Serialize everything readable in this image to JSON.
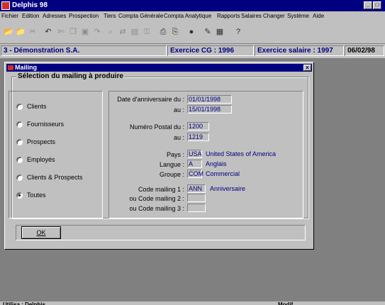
{
  "window": {
    "title": "Delphis 98"
  },
  "menu": [
    "Fichier",
    "Edition",
    "Adresses",
    "Prospection",
    "Tiers",
    "Compta Générale",
    "Compta Analytique",
    "Rapports",
    "Salaires",
    "Changer",
    "Système",
    "Aide"
  ],
  "toolbar": {
    "icons": [
      "open-folder-icon",
      "edit-folder-icon",
      "tools-icon",
      "undo-icon",
      "cut-icon",
      "copy-icon",
      "paste-icon",
      "redo-icon",
      "find-icon",
      "replace-icon",
      "calculator-icon",
      "key-icon",
      "print-preview-icon",
      "print-icon",
      "globe-icon",
      "edit-document-icon",
      "film-icon",
      "help-icon"
    ]
  },
  "status": {
    "company": "3 - Démonstration S.A.",
    "exercice_cg": "Exercice CG : 1996",
    "exercice_salaire": "Exercice salaire :  1997",
    "date": "06/02/98"
  },
  "dialog": {
    "title": "Mailing",
    "group_title": "Sélection du mailing à produire",
    "options": [
      {
        "label": "Clients",
        "selected": false
      },
      {
        "label": "Fournisseurs",
        "selected": false
      },
      {
        "label": "Prospects",
        "selected": false
      },
      {
        "label": "Employés",
        "selected": false
      },
      {
        "label": "Clients & Prospects",
        "selected": false
      },
      {
        "label": "Toutes",
        "selected": true
      }
    ],
    "fields": {
      "date_anniv_du_label": "Date d'anniversaire du :",
      "date_anniv_du": "01/01/1998",
      "date_anniv_au_label": "au :",
      "date_anniv_au": "15/01/1998",
      "npa_du_label": "Numéro Postal du :",
      "npa_du": "1200",
      "npa_au_label": "au :",
      "npa_au": "1219",
      "pays_label": "Pays :",
      "pays_code": "USA",
      "pays_name": "United States of America",
      "langue_label": "Langue :",
      "langue_code": "A",
      "langue_name": "Anglais",
      "groupe_label": "Groupe :",
      "groupe_code": "COM",
      "groupe_name": "Commercial",
      "code1_label": "Code mailing 1 :",
      "code1": "ANN",
      "code1_name": "Anniversaire",
      "code2_label": "ou Code mailing 2 :",
      "code2": "",
      "code3_label": "ou Code mailing 3 :",
      "code3": ""
    },
    "ok_label": "OK"
  },
  "bottom": {
    "user": "Utilisa : Delphis",
    "mode": "Modif"
  }
}
